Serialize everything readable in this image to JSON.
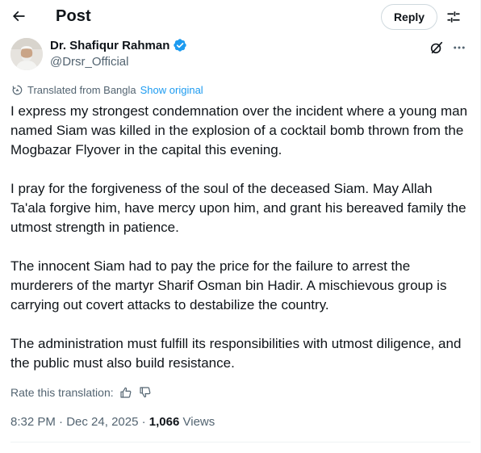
{
  "header": {
    "title": "Post",
    "reply_label": "Reply"
  },
  "author": {
    "name": "Dr. Shafiqur Rahman",
    "handle": "@Drsr_Official",
    "verified": true
  },
  "translation": {
    "from_text": "Translated from Bangla",
    "show_original": "Show original"
  },
  "post": {
    "paragraphs": [
      "I express my strongest condemnation over the incident where a young man named Siam was killed in the explosion of a cocktail bomb thrown from the Mogbazar Flyover in the capital this evening.",
      "I pray for the forgiveness of the soul of the deceased Siam. May Allah Ta'ala forgive him, have mercy upon him, and grant his bereaved family the utmost strength in patience.",
      "The innocent Siam had to pay the price for the failure to arrest the murderers of the martyr Sharif Osman bin Hadir. A mischievous group is carrying out covert attacks to destabilize the country.",
      "The administration must fulfill its responsibilities with utmost diligence, and the public must also build resistance."
    ]
  },
  "rate": {
    "label": "Rate this translation:"
  },
  "meta": {
    "time": "8:32 PM",
    "sep1": " · ",
    "date": "Dec 24, 2025",
    "sep2": " · ",
    "views_count": "1,066",
    "views_label": " Views"
  },
  "colors": {
    "accent": "#1d9bf0",
    "text": "#0f1419",
    "muted": "#536471",
    "border": "#cfd9de",
    "verified": "#1d9bf0"
  },
  "icons": {
    "back": "arrow-left-icon",
    "settings": "sliders-icon",
    "verified": "verified-badge-icon",
    "grok": "grok-icon",
    "more": "more-horizontal-icon",
    "translate": "translate-icon",
    "thumbs_up": "thumbs-up-icon",
    "thumbs_down": "thumbs-down-icon"
  }
}
